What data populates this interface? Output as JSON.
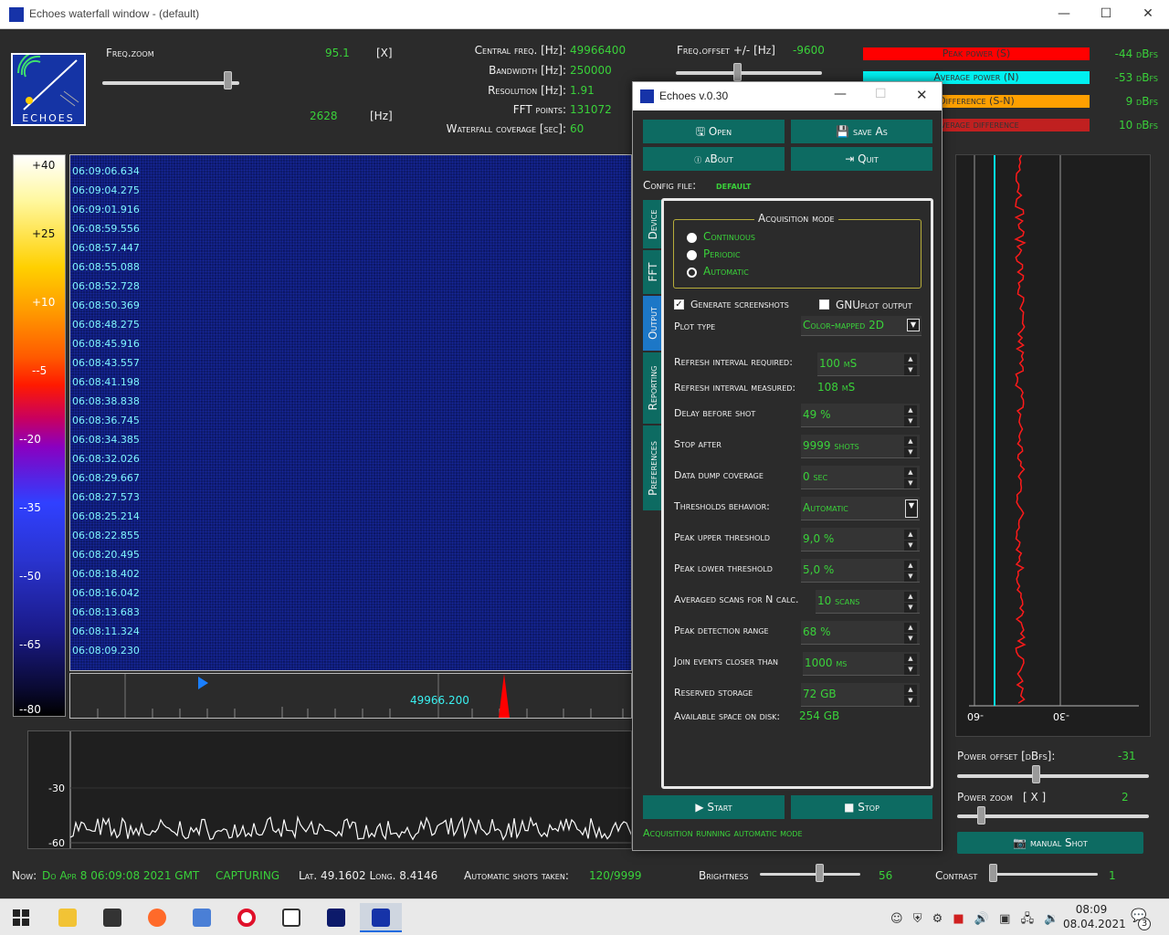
{
  "window": {
    "title": "Echoes waterfall window - (default)",
    "min": "—",
    "max": "☐",
    "close": "✕"
  },
  "logo_text": "ECHOES",
  "freq_zoom": {
    "label": "Freq.zoom",
    "value": "95.1",
    "unit": "[X]",
    "hz_value": "2628",
    "hz_unit": "[Hz]",
    "slider_level": 0.92
  },
  "params": [
    {
      "label": "Central freq. [Hz]:",
      "value": "49966400"
    },
    {
      "label": "Bandwidth [Hz]:",
      "value": "250000"
    },
    {
      "label": "Resolution [Hz]:",
      "value": "1.91"
    },
    {
      "label": "FFT points:",
      "value": "131072"
    },
    {
      "label": "Waterfall coverage [sec]:",
      "value": "60"
    }
  ],
  "freq_offset": {
    "label": "Freq.offset +/- [Hz]",
    "value": "-9600"
  },
  "power_legend": [
    {
      "label": "Peak power (S)",
      "value": "-44 dBfs",
      "color": "#ff0000"
    },
    {
      "label": "Average power (N)",
      "value": "-53 dBfs",
      "color": "#00f0f0"
    },
    {
      "label": "Difference (S-N)",
      "value": "9 dBfs",
      "color": "#ffa000"
    },
    {
      "label": "Average difference",
      "value": "10 dBfs",
      "color": "#c02020"
    }
  ],
  "color_scale": [
    "+40",
    "+25",
    "+10",
    "--5",
    "--20",
    "--35",
    "--50",
    "--65",
    "--80"
  ],
  "timestamps": [
    "06:09:06.634",
    "06:09:04.275",
    "06:09:01.916",
    "06:08:59.556",
    "06:08:57.447",
    "06:08:55.088",
    "06:08:52.728",
    "06:08:50.369",
    "06:08:48.275",
    "06:08:45.916",
    "06:08:43.557",
    "06:08:41.198",
    "06:08:38.838",
    "06:08:36.745",
    "06:08:34.385",
    "06:08:32.026",
    "06:08:29.667",
    "06:08:27.573",
    "06:08:25.214",
    "06:08:22.855",
    "06:08:20.495",
    "06:08:18.402",
    "06:08:16.042",
    "06:08:13.683",
    "06:08:11.324",
    "06:08:09.230"
  ],
  "freq_axis_label": "49966.200",
  "spectrum": {
    "ticks": [
      "-30",
      "-60"
    ]
  },
  "power_plot": {
    "ticks": [
      "-60",
      "-30"
    ]
  },
  "power_offset": {
    "label": "Power offset [dBfs]:",
    "value": "-31"
  },
  "power_zoom": {
    "label": "Power zoom",
    "unit": "[ X ]",
    "value": "2"
  },
  "manual_shot": "manual Shot",
  "status": {
    "now": "Now: ",
    "datetime": "Do Apr 8 06:09:08 2021 GMT",
    "state": "CAPTURING",
    "coords": "Lat. 49.1602 Long. 8.4146",
    "shots_label": "Automatic shots taken: ",
    "shots_value": "120/9999",
    "brightness_label": "Brightness",
    "brightness_value": "56",
    "contrast_label": "Contrast",
    "contrast_value": "1"
  },
  "dialog": {
    "title": "Echoes v.0.30",
    "buttons": {
      "open": "Open",
      "save_as": "save As",
      "about": "aBout",
      "quit": "Quit",
      "start": "Start",
      "stop": "Stop"
    },
    "config_label": "Config file:",
    "config_value": "default",
    "tabs": [
      "Device",
      "FFT",
      "Output",
      "Reporting",
      "Preferences"
    ],
    "acq_title": "Acquisition mode",
    "acq_modes": [
      "Continuous",
      "Periodic",
      "Automatic"
    ],
    "acq_selected": "Automatic",
    "gen_screenshots": "Generate screenshots",
    "gnuplot": "GNUplot output",
    "plot_type_label": "Plot type",
    "plot_type_value": "Color-mapped 2D",
    "rows": [
      {
        "label": "Refresh interval  required:",
        "value": "100 mS"
      },
      {
        "label": "Refresh interval measured:",
        "value": "108 mS"
      },
      {
        "label": "Delay before shot",
        "value": "49 %"
      },
      {
        "label": "Stop after",
        "value": "9999 shots"
      },
      {
        "label": "Data dump coverage",
        "value": "0 sec"
      },
      {
        "label": "Thresholds behavior:",
        "value": "Automatic"
      },
      {
        "label": "Peak upper threshold",
        "value": "9,0 %"
      },
      {
        "label": "Peak lower threshold",
        "value": "5,0 %"
      },
      {
        "label": "Averaged scans for N calc.",
        "value": "10 scans"
      },
      {
        "label": "Peak detection range",
        "value": "68 %"
      },
      {
        "label": "Join events closer than",
        "value": "1000 ms"
      },
      {
        "label": "Reserved storage",
        "value": "72 GB"
      },
      {
        "label": "Available space on disk:",
        "value": "254 GB"
      }
    ],
    "status_text": "Acquisition running automatic mode"
  },
  "taskbar": {
    "time": "08:09",
    "date": "08.04.2021",
    "notif": "3"
  }
}
